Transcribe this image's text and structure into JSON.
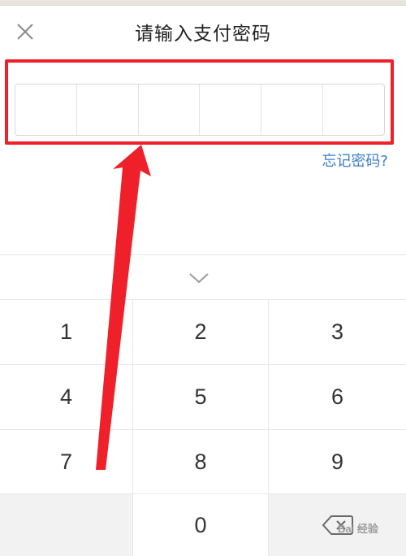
{
  "header": {
    "title": "请输入支付密码",
    "close_icon": "close-icon"
  },
  "pin": {
    "cells": [
      "",
      "",
      "",
      "",
      "",
      ""
    ]
  },
  "forgot_label": "忘记密码?",
  "keyboard": {
    "collapse_icon": "chevron-down-icon",
    "keys": [
      "1",
      "2",
      "3",
      "4",
      "5",
      "6",
      "7",
      "8",
      "9",
      "",
      "0",
      "⌫"
    ],
    "delete_icon": "backspace-icon"
  },
  "annotation": {
    "color": "#f0202a"
  },
  "watermark": {
    "text": "Bai 经验"
  },
  "colors": {
    "link": "#3a7fc4",
    "annotation_red": "#f0202a",
    "key_text": "#333333"
  }
}
